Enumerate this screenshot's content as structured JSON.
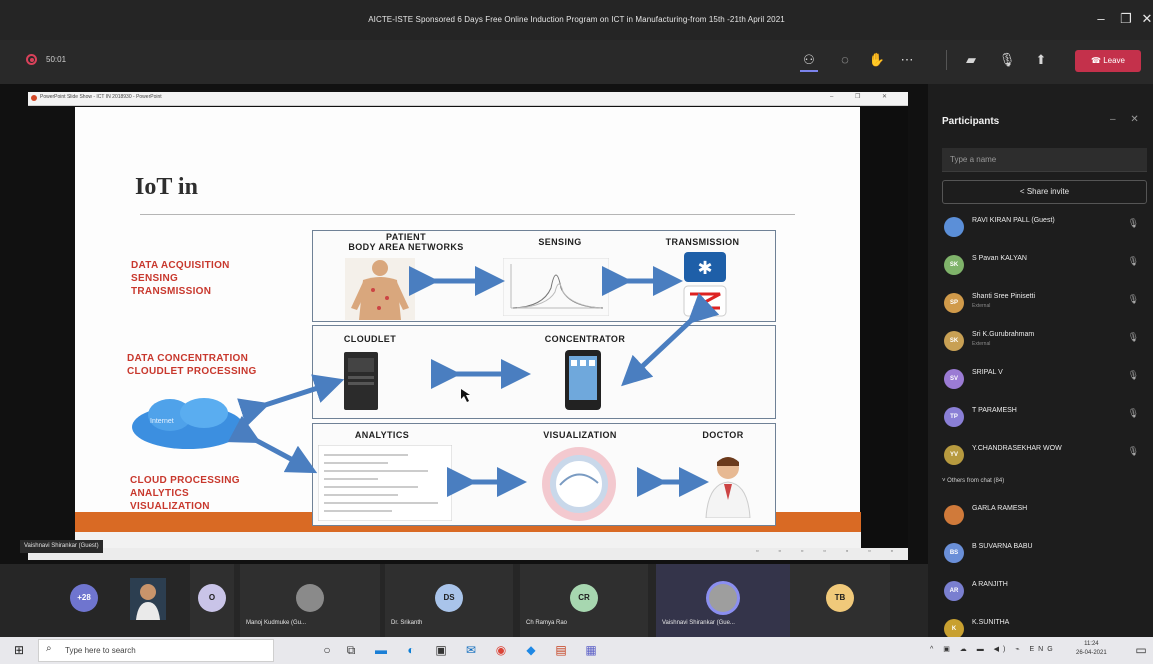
{
  "window": {
    "title": "AICTE-ISTE Sponsored 6 Days Free Online Induction Program on ICT in Manufacturing-from 15th -21th April 2021"
  },
  "meeting": {
    "timer": "50:01",
    "leave_label": "Leave",
    "leave_color": "#c4314b",
    "toolbar_icons": [
      "people-icon",
      "chat-icon",
      "reactions-icon",
      "more-icon",
      "camera-icon",
      "mic-icon",
      "share-icon"
    ]
  },
  "ppt": {
    "window_title": "PowerPoint Slide Show - ICT IN 2018930 - PowerPoint",
    "speaker_label": "Vaishnavi Shirankar (Guest)"
  },
  "slide": {
    "heading": "IoT in",
    "left_labels": {
      "group1": [
        "DATA ACQUISITION",
        "SENSING",
        "TRANSMISSION"
      ],
      "group2": [
        "DATA CONCENTRATION",
        "CLOUDLET PROCESSING"
      ],
      "group3": [
        "CLOUD PROCESSING",
        "ANALYTICS",
        "VISUALIZATION"
      ]
    },
    "row1": {
      "patient": [
        "PATIENT",
        "BODY AREA NETWORKS"
      ],
      "sensing": "SENSING",
      "transmission": "TRANSMISSION"
    },
    "row2": {
      "cloudlet": "CLOUDLET",
      "concentrator": "CONCENTRATOR"
    },
    "row3": {
      "analytics": "ANALYTICS",
      "visualization": "VISUALIZATION",
      "doctor": "DOCTOR"
    },
    "cloud_label": "Internet"
  },
  "participants": {
    "title": "Participants",
    "search_placeholder": "Type a name",
    "share_invite": "Share invite",
    "people": [
      {
        "initials": "",
        "name": "RAVI KIRAN PALL (Guest)",
        "sub": "",
        "color": "#5b8fd8"
      },
      {
        "initials": "SK",
        "name": "S Pavan KALYAN",
        "sub": "",
        "color": "#7fb36a"
      },
      {
        "initials": "SP",
        "name": "Shanti Sree Pinisetti",
        "sub": "External",
        "color": "#d09a4a"
      },
      {
        "initials": "SK",
        "name": "Sri K.Gurubrahmam",
        "sub": "External",
        "color": "#c8a054"
      },
      {
        "initials": "SV",
        "name": "SRIPAL V",
        "sub": "",
        "color": "#9b7bd4"
      },
      {
        "initials": "TP",
        "name": "T PARAMESH",
        "sub": "",
        "color": "#8a7fd6"
      },
      {
        "initials": "YV",
        "name": "Y.CHANDRASEKHAR WOW",
        "sub": "",
        "color": "#b79a3f"
      }
    ],
    "others_section": "Others from chat (84)",
    "others": [
      {
        "initials": "",
        "name": "GARLA RAMESH",
        "color": "#d07a3a"
      },
      {
        "initials": "BS",
        "name": "B SUVARNA BABU",
        "color": "#6a8fd8"
      },
      {
        "initials": "AR",
        "name": "A RANJITH",
        "color": "#7a7fd0"
      },
      {
        "initials": "K",
        "name": "K.SUNITHA",
        "color": "#c8a030"
      }
    ]
  },
  "gallery": {
    "overflow_count": "+28",
    "tiles": [
      {
        "initials": "O",
        "name": "",
        "color": "#c9c4e8"
      },
      {
        "initials": "",
        "name": "Manoj Kudmuke (Gu...",
        "color": "#8a8a8a"
      },
      {
        "initials": "DS",
        "name": "Dr. Srikanth",
        "color": "#a9c4ea"
      },
      {
        "initials": "CR",
        "name": "Ch Ramya Rao",
        "color": "#a7d7b0"
      },
      {
        "initials": "",
        "name": "Vaishnavi Shirankar (Gue...",
        "color": "#9e9e9e"
      },
      {
        "initials": "TB",
        "name": "",
        "color": "#f0c97a"
      }
    ]
  },
  "taskbar": {
    "search_placeholder": "Type here to search",
    "time": "11:24",
    "date": "26-04-2021",
    "lang": "ENG"
  }
}
